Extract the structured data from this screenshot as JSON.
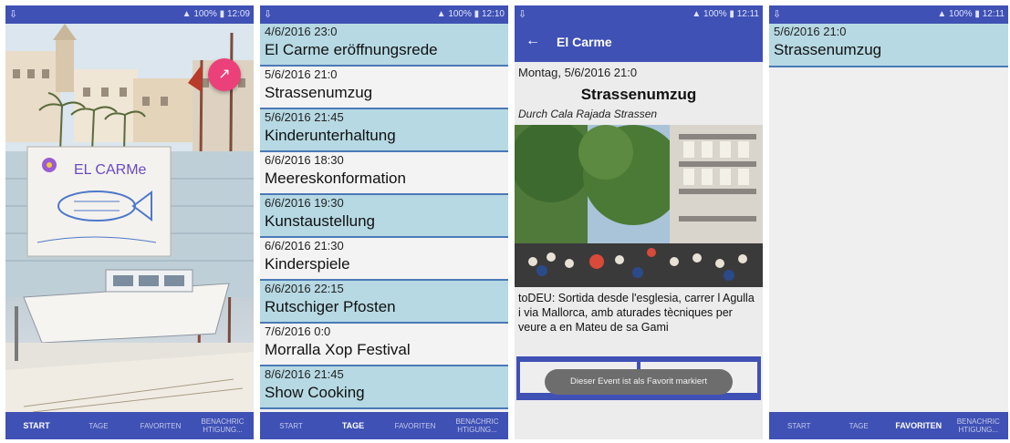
{
  "status": {
    "notif_icon": "download-icon",
    "signal_text": "100%",
    "time_1": "12:09",
    "time_2": "12:10",
    "time_3": "12:11",
    "time_4": "12:11"
  },
  "nav": {
    "start": "START",
    "tage": "TAGE",
    "favoriten": "FAVORITEN",
    "benachrichtigung": "BENACHRIC\nHTIGUNG..."
  },
  "screen1": {
    "fab_icon": "arrow-icon",
    "fab_glyph": "↗",
    "painting_text": "EL CARMe"
  },
  "screen2": {
    "items": [
      {
        "date": "4/6/2016 23:0",
        "title": "El Carme eröffnungsrede"
      },
      {
        "date": "5/6/2016 21:0",
        "title": "Strassenumzug"
      },
      {
        "date": "5/6/2016 21:45",
        "title": "Kinderunterhaltung"
      },
      {
        "date": "6/6/2016 18:30",
        "title": "Meereskonformation"
      },
      {
        "date": "6/6/2016 19:30",
        "title": "Kunstaustellung"
      },
      {
        "date": "6/6/2016 21:30",
        "title": "Kinderspiele"
      },
      {
        "date": "6/6/2016 22:15",
        "title": "Rutschiger Pfosten"
      },
      {
        "date": "7/6/2016 0:0",
        "title": "Morralla Xop Festival"
      },
      {
        "date": "8/6/2016 21:45",
        "title": "Show Cooking"
      }
    ]
  },
  "screen3": {
    "title": "El Carme",
    "date": "Montag, 5/6/2016 21:0",
    "event_title": "Strassenumzug",
    "subtitle": "Durch Cala Rajada Strassen",
    "description": "toDEU: Sortida desde l'esglesia, carrer l Agulla i via Mallorca, amb aturades tècniques per veure a en Mateu de sa Gami",
    "toast": "Dieser Event ist als Favorit markiert"
  },
  "screen4": {
    "date": "5/6/2016 21:0",
    "title": "Strassenumzug"
  },
  "colors": {
    "primary": "#3f51b5",
    "list_highlight": "#b6d9e3",
    "fab": "#ec407a"
  }
}
